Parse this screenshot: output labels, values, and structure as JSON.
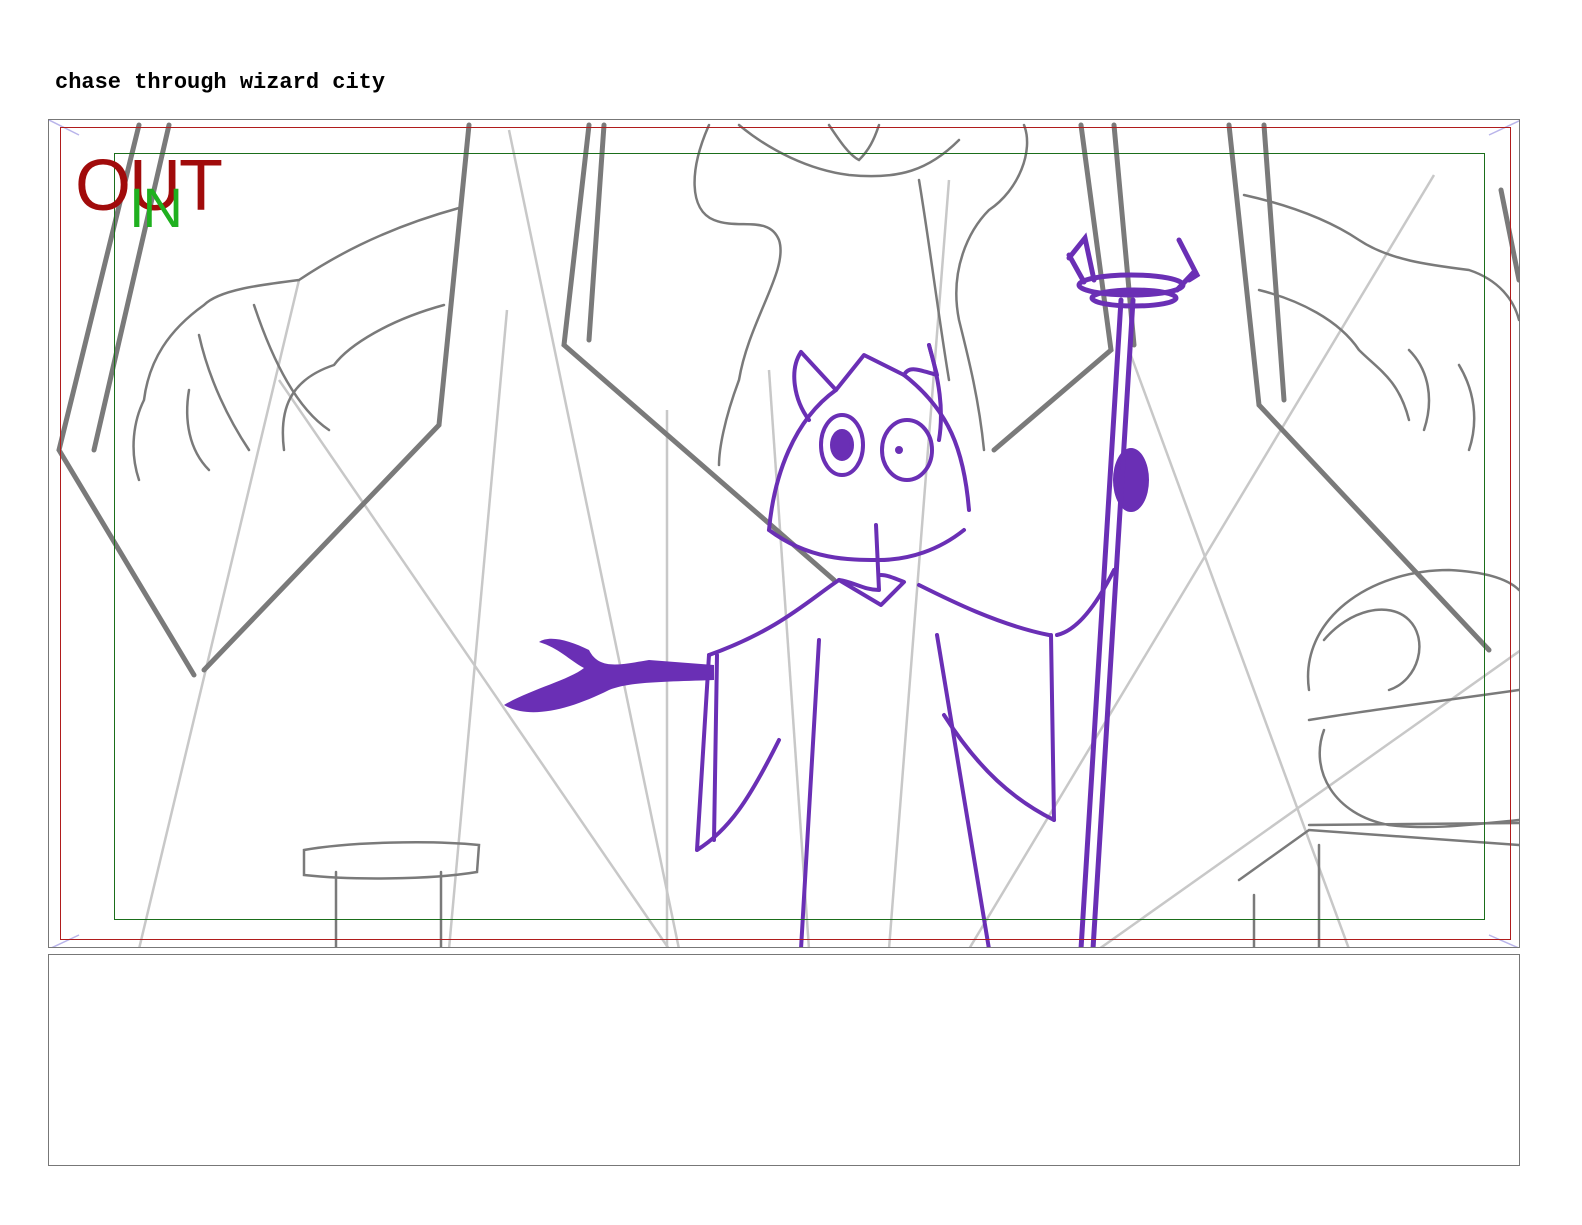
{
  "scene": {
    "title": "chase through wizard city"
  },
  "panel": {
    "frame_out_label": "OUT",
    "frame_in_label": "IN",
    "colors": {
      "out_frame": "#a10b0b",
      "in_frame": "#1fb01f",
      "character": "#6a2fb5",
      "background_lines": "#7a7a7a"
    },
    "illustration": "wizard-character-sketch"
  },
  "notes": {
    "text": ""
  }
}
